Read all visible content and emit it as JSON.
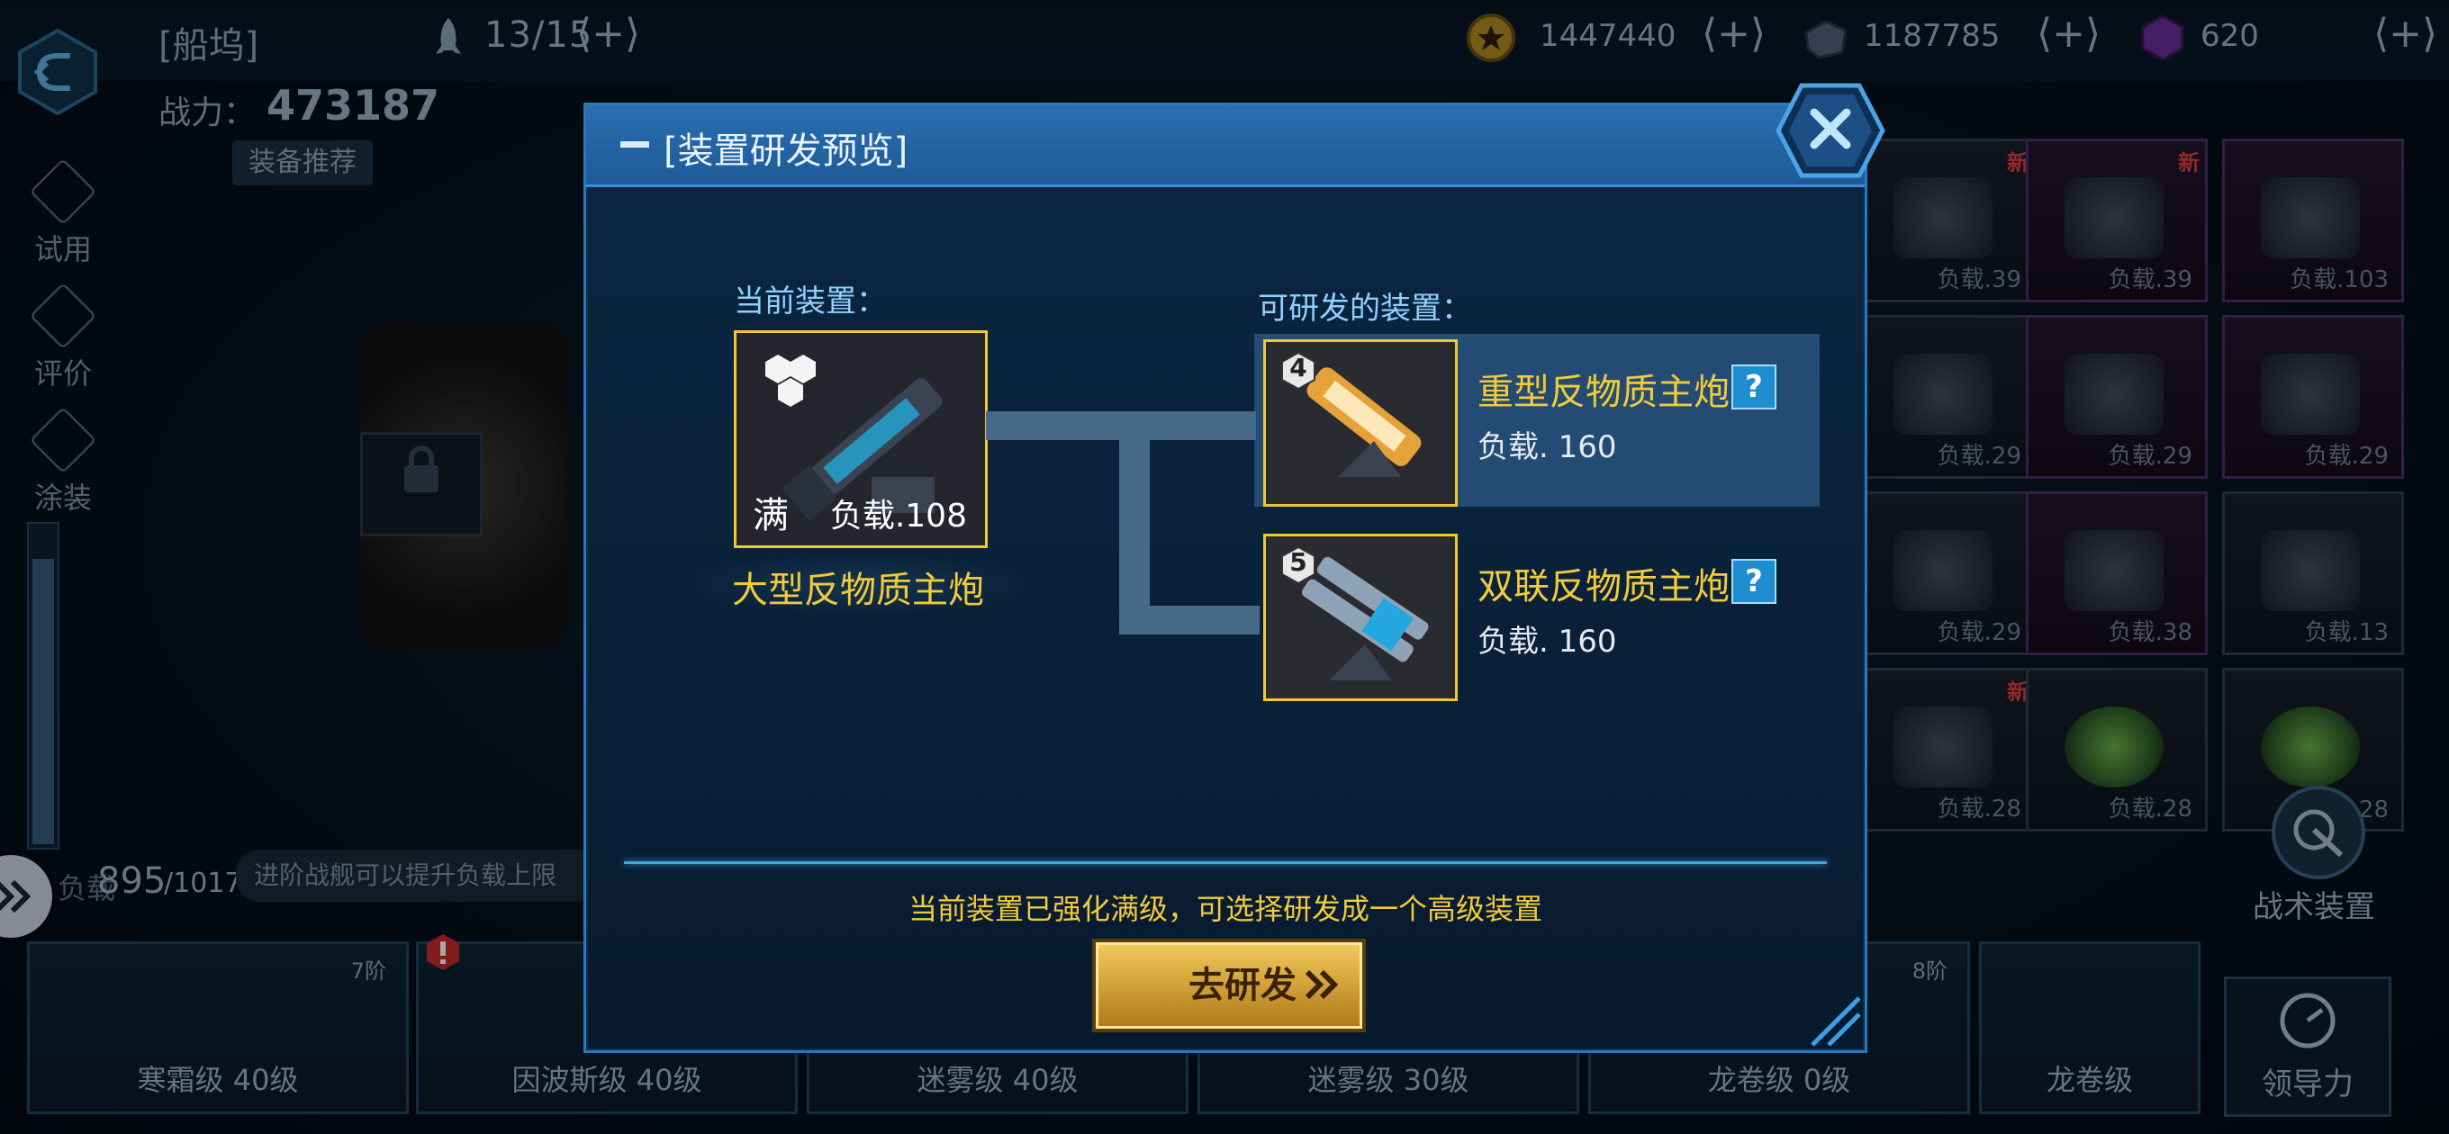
{
  "topbar": {
    "dock_title": "[船坞]",
    "fleet_count": "13/15",
    "resources": [
      {
        "icon": "gold-coin-icon",
        "value": "1447440"
      },
      {
        "icon": "metal-ore-icon",
        "value": "1187785"
      },
      {
        "icon": "purple-crystal-icon",
        "value": "620"
      }
    ]
  },
  "left_panel": {
    "power_label": "战力：",
    "power_value": "473187",
    "recommend": "装备推荐",
    "side_items": [
      "试用",
      "评价",
      "涂装"
    ],
    "capacity_label": "负载",
    "capacity_value": "895",
    "capacity_max": "/1017",
    "capacity_tip": "进阶战舰可以提升负载上限"
  },
  "equipment_grid": {
    "cells": [
      {
        "new": "新",
        "load": "负载.39"
      },
      {
        "new": "新",
        "load": "负载.39"
      },
      {
        "new": "",
        "load": "负载.103"
      },
      {
        "new": "",
        "load": "负载.29"
      },
      {
        "new": "",
        "load": "负载.29"
      },
      {
        "new": "",
        "load": "负载.29"
      },
      {
        "new": "",
        "load": "负载.29"
      },
      {
        "new": "",
        "load": "负载.38"
      },
      {
        "new": "",
        "load": "负载.13"
      },
      {
        "new": "新",
        "load": "负载.28"
      },
      {
        "new": "",
        "load": "负载.28"
      },
      {
        "new": "",
        "load": ".28"
      }
    ],
    "tactical_label": "战术装置"
  },
  "ships": [
    {
      "name": "寒霜级 40级",
      "rank": "7阶"
    },
    {
      "name": "因波斯级 40级",
      "rank": ""
    },
    {
      "name": "迷雾级 40级",
      "rank": ""
    },
    {
      "name": "迷雾级 30级",
      "rank": ""
    },
    {
      "name": "龙卷级 0级",
      "rank": "8阶"
    },
    {
      "name": "龙卷级",
      "rank": ""
    }
  ],
  "leader_label": "领导力",
  "modal": {
    "title": "[装置研发预览]",
    "current_label": "当前装置：",
    "current": {
      "badge": "满",
      "load": "负载.108",
      "name": "大型反物质主炮",
      "stars": 3
    },
    "researchable_label": "可研发的装置：",
    "options": [
      {
        "tier": "4",
        "name": "重型反物质主炮",
        "help": "?",
        "load": "负载. 160"
      },
      {
        "tier": "5",
        "name": "双联反物质主炮",
        "help": "?",
        "load": "负载. 160"
      }
    ],
    "hint": "当前装置已强化满级，可选择研发成一个高级装置",
    "go_button": "去研发"
  },
  "colors": {
    "accent_gold": "#f2cb3a",
    "modal_blue": "#1e5a98",
    "highlight_row": "#3a6ea0",
    "new_red": "#e04040"
  }
}
